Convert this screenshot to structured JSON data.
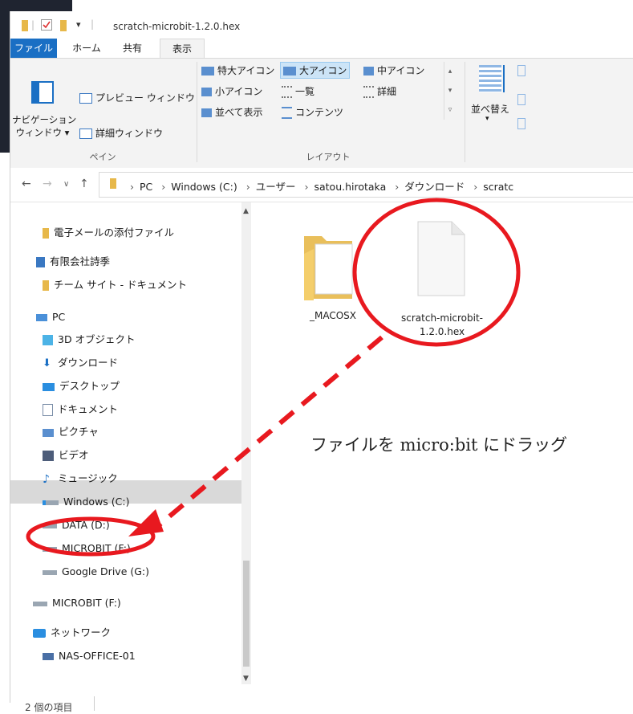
{
  "window": {
    "title": "scratch-microbit-1.2.0.hex",
    "dropdown_glyph": "▾"
  },
  "ribbon": {
    "tabs": [
      {
        "label": "ファイル"
      },
      {
        "label": "ホーム"
      },
      {
        "label": "共有"
      },
      {
        "label": "表示"
      }
    ],
    "pane_group": {
      "navigation_pane": "ナビゲーション ウィンドウ",
      "navigation_pane_line1": "ナビゲーション",
      "navigation_pane_line2": "ウィンドウ",
      "preview_pane": "プレビュー ウィンドウ",
      "details_pane": "詳細ウィンドウ",
      "label": "ペイン"
    },
    "layout_group": {
      "extra_large_icons": "特大アイコン",
      "large_icons": "大アイコン",
      "medium_icons": "中アイコン",
      "small_icons": "小アイコン",
      "list": "一覧",
      "details": "詳細",
      "tiles": "並べて表示",
      "content": "コンテンツ",
      "label": "レイアウト"
    },
    "sort_group": {
      "sort_by": "並べ替え"
    }
  },
  "addressbar": {
    "breadcrumbs": [
      "PC",
      "Windows (C:)",
      "ユーザー",
      "satou.hirotaka",
      "ダウンロード",
      "scratc"
    ]
  },
  "navpane": {
    "items": [
      {
        "label": "電子メールの添付ファイル",
        "icon": "folder-icon"
      },
      {
        "label": "有限会社詩季",
        "icon": "building-icon"
      },
      {
        "label": "チーム サイト - ドキュメント",
        "icon": "folder-icon"
      },
      {
        "label": "PC",
        "icon": "computer-icon"
      },
      {
        "label": "3D オブジェクト",
        "icon": "cube-icon"
      },
      {
        "label": "ダウンロード",
        "icon": "download-icon"
      },
      {
        "label": "デスクトップ",
        "icon": "desktop-icon"
      },
      {
        "label": "ドキュメント",
        "icon": "document-icon"
      },
      {
        "label": "ピクチャ",
        "icon": "pictures-icon"
      },
      {
        "label": "ビデオ",
        "icon": "video-icon"
      },
      {
        "label": "ミュージック",
        "icon": "music-icon"
      },
      {
        "label": "Windows (C:)",
        "icon": "windows-drive-icon"
      },
      {
        "label": "DATA (D:)",
        "icon": "drive-icon"
      },
      {
        "label": "MICROBIT (F:)",
        "icon": "drive-icon"
      },
      {
        "label": "Google Drive (G:)",
        "icon": "drive-icon"
      },
      {
        "label": "MICROBIT (F:)",
        "icon": "drive-icon"
      },
      {
        "label": "ネットワーク",
        "icon": "network-icon"
      },
      {
        "label": "NAS-OFFICE-01",
        "icon": "computer-icon"
      }
    ]
  },
  "content": {
    "files": [
      {
        "label": "_MACOSX",
        "icon": "folder-icon"
      },
      {
        "label_line1": "scratch-microbit-",
        "label_line2": "1.2.0.hex",
        "icon": "file-icon"
      }
    ],
    "annotation": "ファイルを micro:bit にドラッグ",
    "annotation_color": "#e8191f"
  },
  "statusbar": {
    "item_count": "2 個の項目"
  }
}
